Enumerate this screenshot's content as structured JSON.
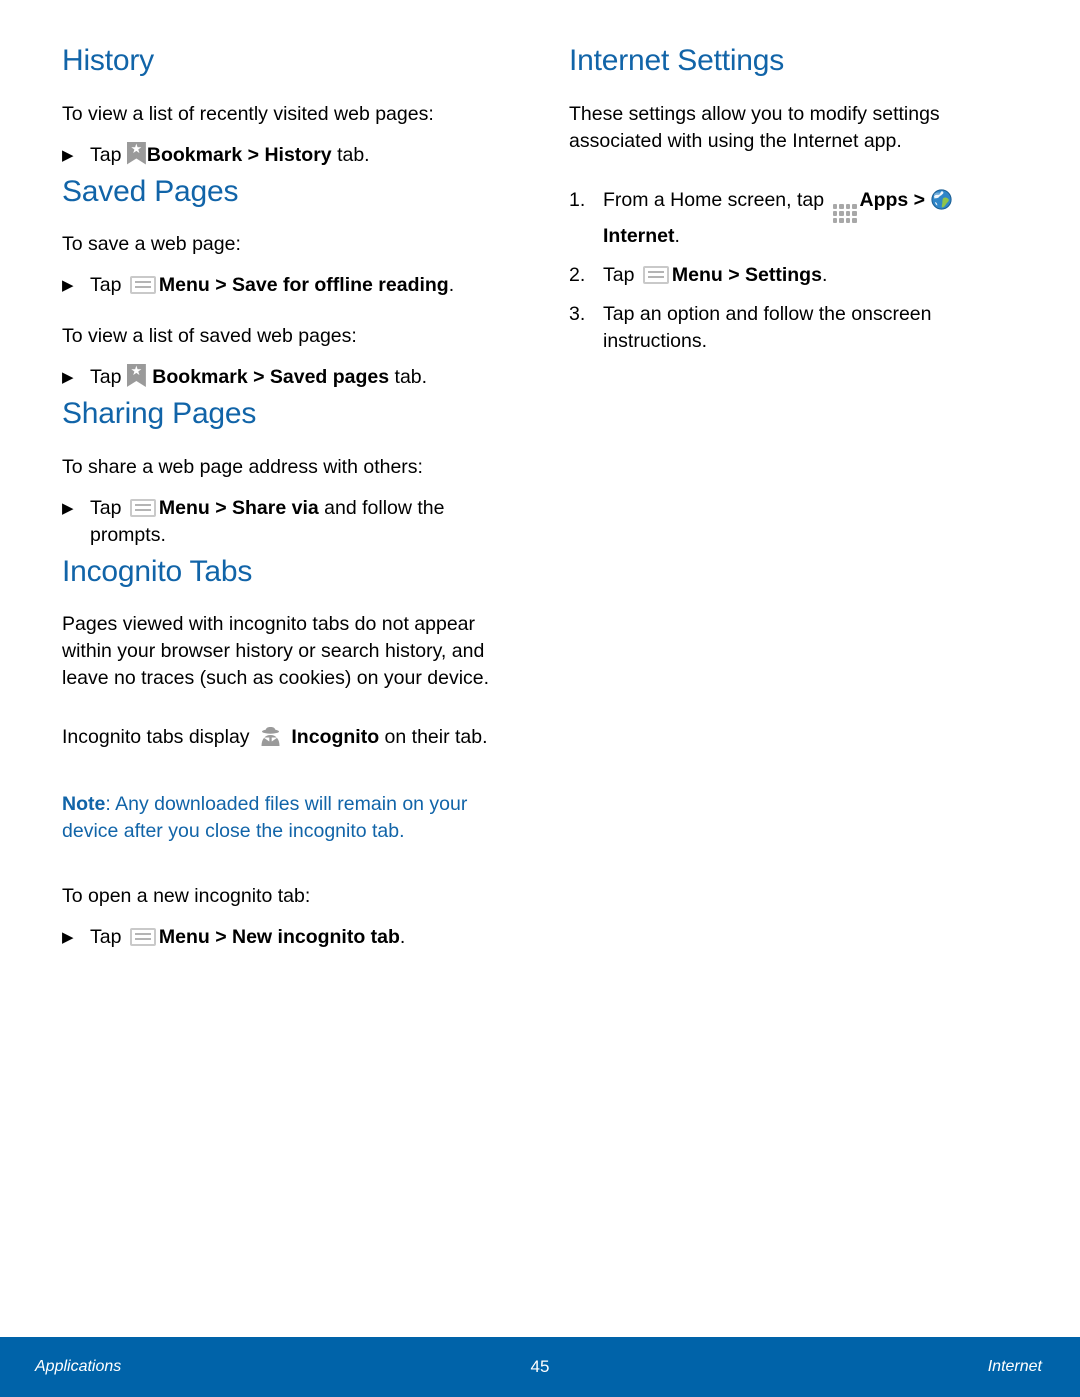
{
  "document": {
    "page_number": "45",
    "footer_left": "Applications",
    "footer_right": "Internet",
    "heading_color": "#1164A8",
    "footer_color": "#0063A9"
  },
  "left_column": {
    "history": {
      "title": "History",
      "intro": "To view a list of recently visited web pages:",
      "step": {
        "arrow": "▶",
        "tap_label": "Tap",
        "icon": "bookmark-icon",
        "bold_1": "Bookmark > History",
        "trail": " tab."
      }
    },
    "saved_pages": {
      "title": "Saved Pages",
      "intro_1": "To save a web page:",
      "step_1": {
        "arrow": "▶",
        "tap_label": "Tap",
        "icon": "menu-icon",
        "bold_1": "Menu > Save for offline reading",
        "trail": "."
      },
      "intro_2": "To view a list of saved web pages:",
      "step_2": {
        "arrow": "▶",
        "tap_label": "Tap",
        "icon": "bookmark-icon",
        "bold_1": "Bookmark > Saved pages",
        "trail": " tab."
      }
    },
    "sharing_pages": {
      "title": "Sharing Pages",
      "intro": "To share a web page address with others:",
      "step": {
        "arrow": "▶",
        "tap_label": "Tap",
        "icon": "menu-icon",
        "bold_1": "Menu > Share via",
        "trail": " and follow the prompts."
      }
    },
    "incognito_tabs": {
      "title": "Incognito Tabs",
      "paragraph": "Pages viewed with incognito tabs do not appear within your browser history or search history, and leave no traces (such as cookies) on your device.",
      "display_line": {
        "lead": "Incognito tabs display",
        "icon": "incognito-icon",
        "bold_1": "Incognito",
        "trail": " on their tab."
      },
      "note": {
        "label": "Note",
        "text": ": Any downloaded files will remain on your device after you close the incognito tab."
      },
      "intro_2": "To open a new incognito tab:",
      "step": {
        "arrow": "▶",
        "tap_label": "Tap",
        "icon": "menu-icon",
        "bold_1": "Menu > New incognito tab",
        "trail": "."
      }
    }
  },
  "right_column": {
    "internet_settings": {
      "title": "Internet Settings",
      "paragraph": "These settings allow you to modify settings associated with using the Internet app.",
      "steps": [
        {
          "marker": "1.",
          "lead": "From a Home screen, tap",
          "icon_1": "apps-grid-icon",
          "bold_1": "Apps >",
          "icon_2": "globe-icon",
          "bold_2": "Internet",
          "trail": "."
        },
        {
          "marker": "2.",
          "lead": "Tap",
          "icon_1": "menu-icon",
          "bold_1": "Menu > Settings",
          "trail": "."
        },
        {
          "marker": "3.",
          "lead": "Tap an option and follow the onscreen instructions.",
          "bold_1": "",
          "trail": ""
        }
      ]
    }
  }
}
